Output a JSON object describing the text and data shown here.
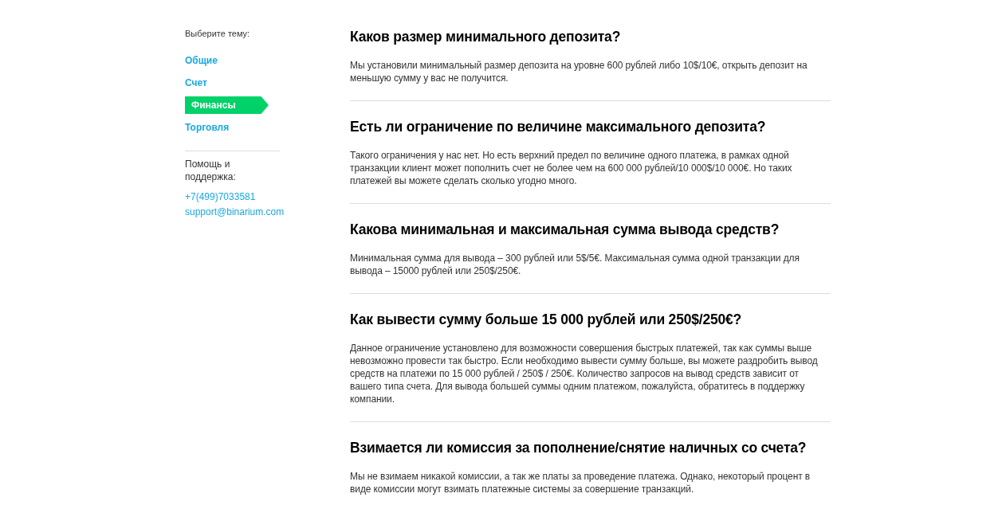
{
  "sidebar": {
    "label": "Выберите тему:",
    "items": [
      {
        "label": "Общие",
        "selected": false
      },
      {
        "label": "Счет",
        "selected": false
      },
      {
        "label": "Финансы",
        "selected": true
      },
      {
        "label": "Торговля",
        "selected": false
      }
    ],
    "help": {
      "label": "Помощь и поддержка:",
      "phone": "+7(499)7033581",
      "email": "support@binarium.com"
    }
  },
  "faq": [
    {
      "question": "Каков размер минимального депозита?",
      "answer": "Мы установили минимальный размер депозита на уровне 600 рублей либо 10$/10€, открыть депозит на меньшую сумму у вас не получится."
    },
    {
      "question": "Есть ли ограничение по величине максимального депозита?",
      "answer": "Такого ограничения у нас нет. Но есть верхний предел по величине одного платежа, в рамках одной транзакции клиент может пополнить счет не более чем на 600 000 рублей/10 000$/10 000€. Но таких платежей вы можете сделать сколько угодно много."
    },
    {
      "question": "Какова минимальная и максимальная сумма вывода средств?",
      "answer": "Минимальная сумма для вывода – 300 рублей или 5$/5€. Максимальная сумма одной транзакции для вывода – 15000 рублей или 250$/250€."
    },
    {
      "question": "Как вывести сумму больше 15 000 рублей или 250$/250€?",
      "answer": "Данное ограничение установлено для возможности совершения быстрых платежей, так как суммы выше невозможно провести так быстро. Если необходимо вывести сумму больше, вы можете раздробить вывод средств на платежи по 15 000 рублей / 250$ / 250€. Количество запросов на вывод средств зависит от вашего типа счета. Для вывода большей суммы одним платежом, пожалуйста, обратитесь в поддержку компании."
    },
    {
      "question": "Взимается ли комиссия за пополнение/снятие наличных со счета?",
      "answer": "Мы не взимаем никакой комиссии, а так же платы за проведение платежа. Однако, некоторый процент в виде комиссии могут взимать платежные системы за совершение транзакций."
    }
  ]
}
